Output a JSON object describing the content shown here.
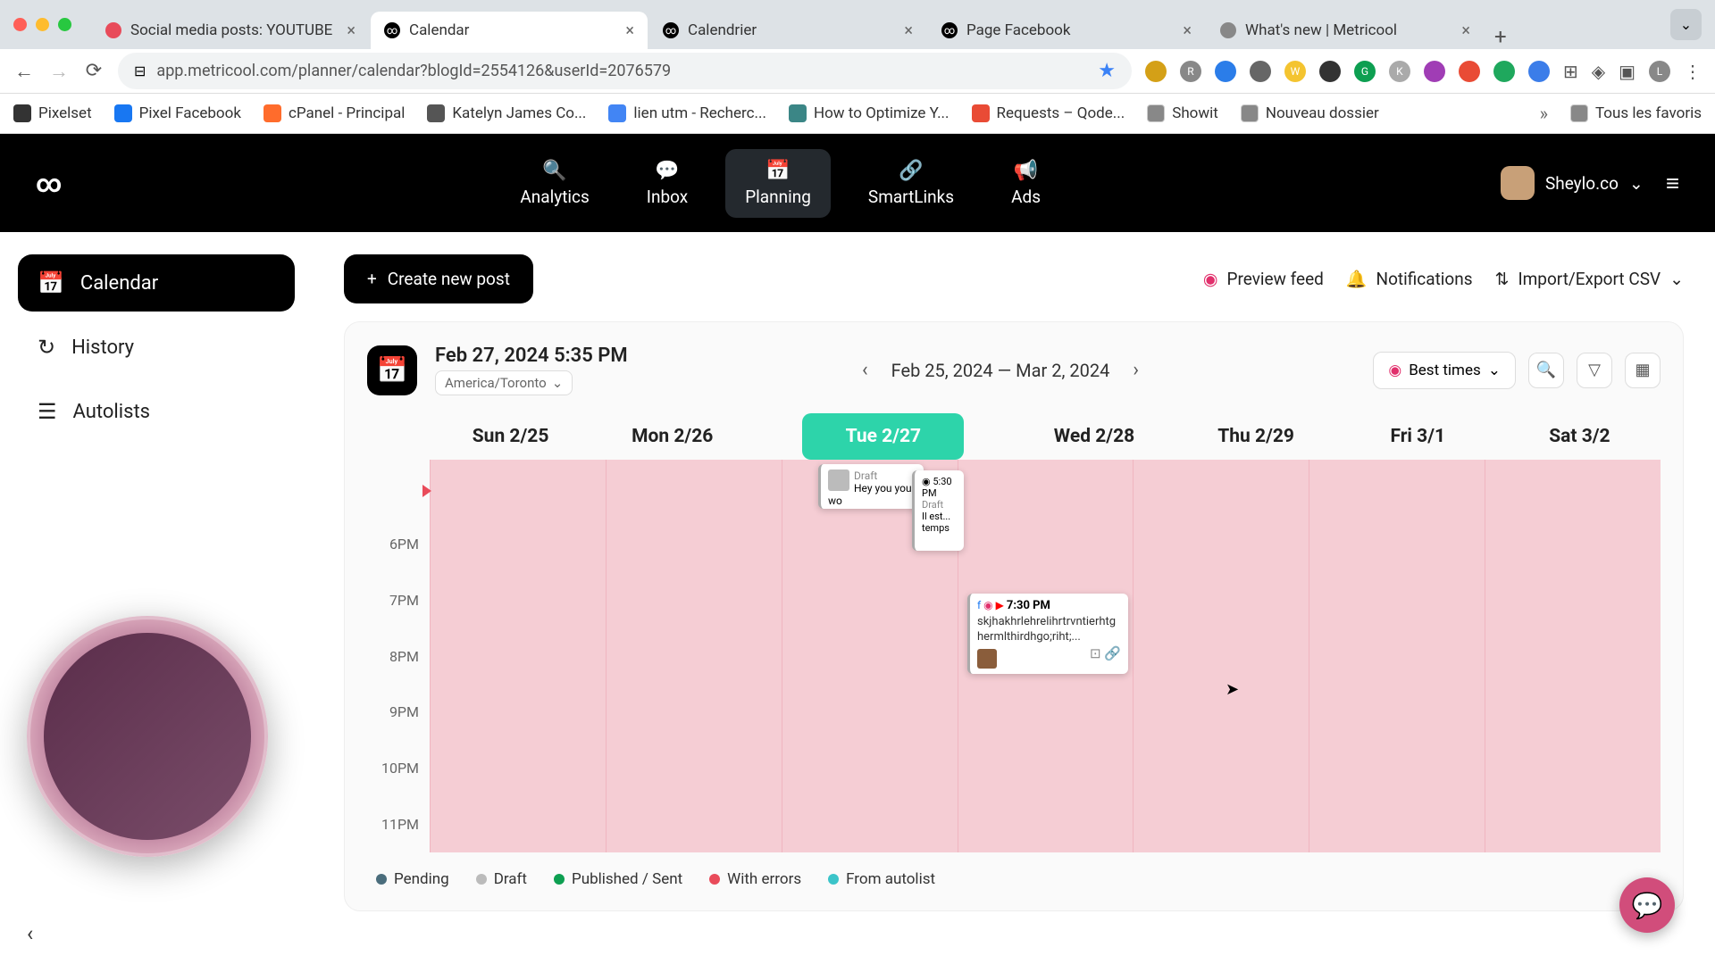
{
  "browser": {
    "tabs": [
      {
        "title": "Social media posts: YOUTUBE",
        "icon_color": "#e84b5a"
      },
      {
        "title": "Calendar",
        "icon_color": "#000"
      },
      {
        "title": "Calendrier",
        "icon_color": "#000"
      },
      {
        "title": "Page Facebook",
        "icon_color": "#000"
      },
      {
        "title": "What's new | Metricool",
        "icon_color": "#666"
      }
    ],
    "url": "app.metricool.com/planner/calendar?blogId=2554126&userId=2076579"
  },
  "bookmarks": [
    "Pixelset",
    "Pixel Facebook",
    "cPanel - Principal",
    "Katelyn James Co...",
    "lien utm - Recherc...",
    "How to Optimize Y...",
    "Requests – Qode...",
    "Showit",
    "Nouveau dossier"
  ],
  "bookmarks_all": "Tous les favoris",
  "nav": {
    "analytics": "Analytics",
    "inbox": "Inbox",
    "planning": "Planning",
    "smartlinks": "SmartLinks",
    "ads": "Ads"
  },
  "user_name": "Sheylo.co",
  "sidebar": {
    "calendar": "Calendar",
    "history": "History",
    "autolists": "Autolists"
  },
  "toolbar": {
    "create": "Create new post",
    "preview": "Preview feed",
    "notifications": "Notifications",
    "import_export": "Import/Export CSV"
  },
  "calendar": {
    "current_datetime": "Feb 27, 2024 5:35 PM",
    "timezone": "America/Toronto",
    "range": "Feb 25, 2024  —  Mar 2, 2024",
    "best_times": "Best times",
    "days": [
      "Sun 2/25",
      "Mon 2/26",
      "Tue 2/27",
      "Wed 2/28",
      "Thu 2/29",
      "Fri 3/1",
      "Sat 3/2"
    ],
    "times": [
      "",
      "6PM",
      "7PM",
      "8PM",
      "9PM",
      "10PM",
      "11PM"
    ],
    "posts": {
      "p1": {
        "status": "Draft",
        "text": "Hey you your wo"
      },
      "p2": {
        "time": "5:30 PM",
        "status": "Draft",
        "text": "Il est... temps"
      },
      "p3": {
        "time": "7:30 PM",
        "text": "skjhakhrlehrelihrtrvntierhtghermlthirdhgo;riht;..."
      }
    }
  },
  "legend": {
    "pending": "Pending",
    "draft": "Draft",
    "published": "Published / Sent",
    "errors": "With errors",
    "autolist": "From autolist"
  }
}
